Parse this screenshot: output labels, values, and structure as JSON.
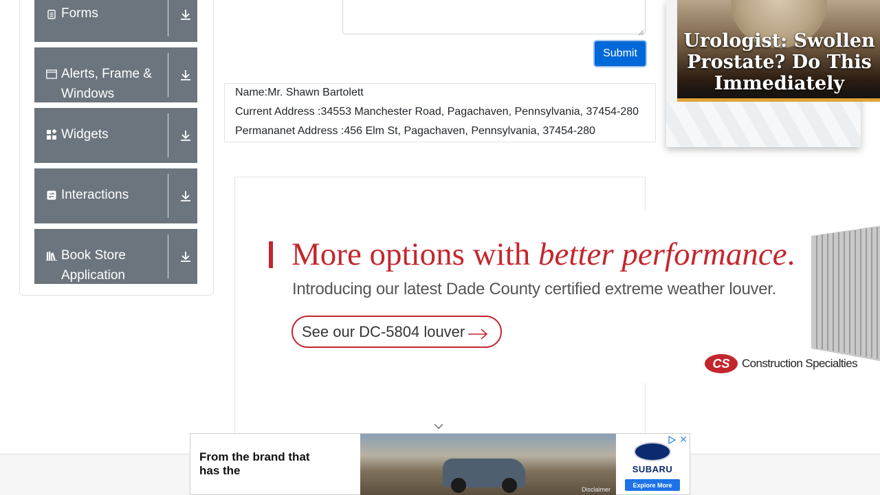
{
  "sidebar": {
    "groups": [
      {
        "label": "Forms",
        "icon": "form-icon"
      },
      {
        "label": "Alerts, Frame & Windows",
        "icon": "window-icon"
      },
      {
        "label": "Widgets",
        "icon": "widgets-icon"
      },
      {
        "label": "Interactions",
        "icon": "interactions-icon"
      },
      {
        "label": "Book Store Application",
        "icon": "books-icon"
      }
    ]
  },
  "form": {
    "submit_label": "Submit"
  },
  "output": {
    "name": "Name:Mr. Shawn Bartolett",
    "current_address": "Current Address :34553 Manchester Road, Pagachaven, Pennsylvania, 37454-280",
    "permanent_address": "Permananet Address :456 Elm St, Pagachaven, Pennsylvania, 37454-280"
  },
  "ad_right": {
    "text": "Urologist: Swollen Prostate? Do This Immediately"
  },
  "ad_big": {
    "headline_plain": "More options with ",
    "headline_em": "better performance",
    "headline_end": ".",
    "subline": "Introducing our latest Dade County certified extreme weather louver.",
    "cta": "See our DC-5804 louver",
    "logo_mark": "CS",
    "logo_name": "Construction Specialties",
    "accent": "#c4262e"
  },
  "ad_bottom": {
    "text": "From the brand that has the",
    "disclaimer": "Disclaimer",
    "brand": "SUBARU",
    "cta": "Explore More",
    "close": "✕"
  },
  "colors": {
    "sidebar_group_bg": "#6c757d",
    "submit_bg": "#0069d9"
  }
}
